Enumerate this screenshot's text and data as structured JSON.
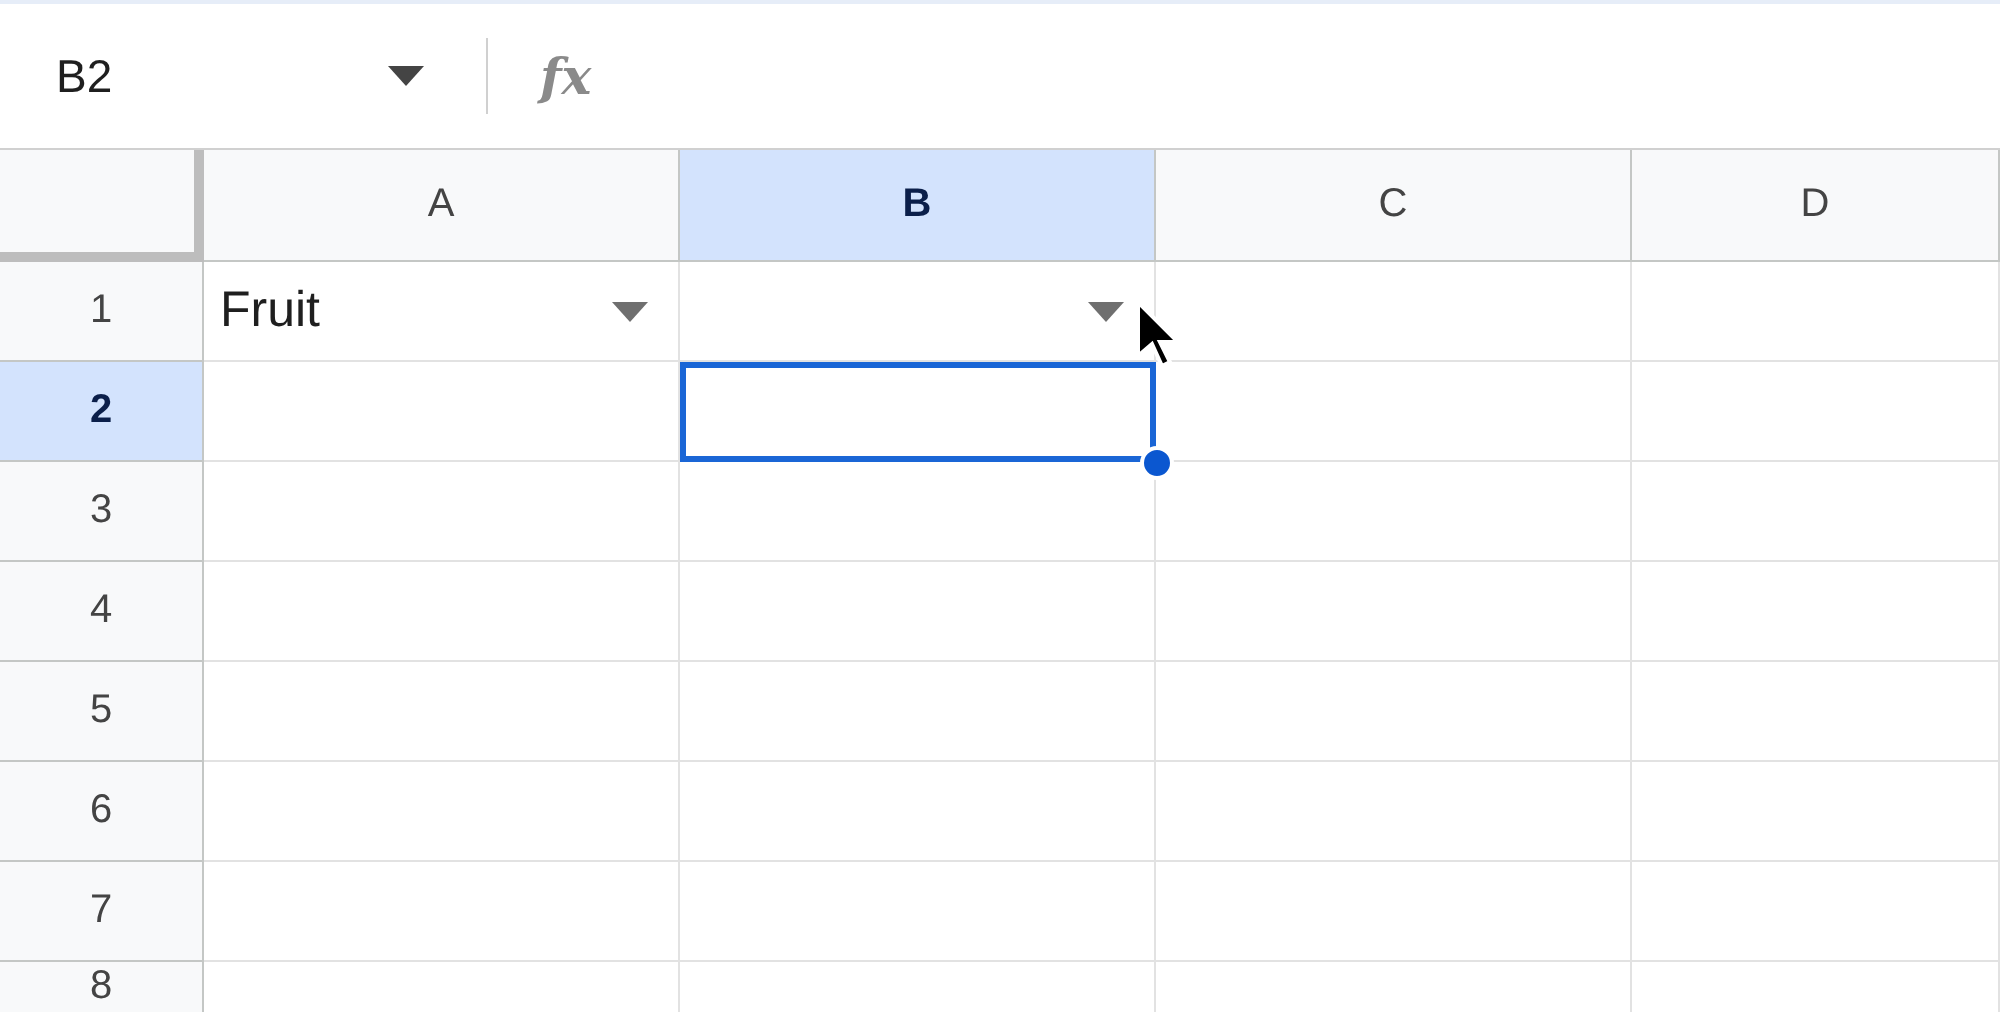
{
  "name_box": {
    "value": "B2"
  },
  "formula_bar": {
    "label": "fx"
  },
  "columns": [
    {
      "label": "A",
      "selected": false
    },
    {
      "label": "B",
      "selected": true
    },
    {
      "label": "C",
      "selected": false
    },
    {
      "label": "D",
      "selected": false
    }
  ],
  "rows": [
    {
      "label": "1",
      "selected": false,
      "cells": [
        {
          "value": "Fruit",
          "dropdown": true,
          "selected": false
        },
        {
          "dropdown": true,
          "selected": false
        },
        {
          "dropdown": false,
          "selected": false
        },
        {
          "dropdown": false,
          "selected": false
        }
      ]
    },
    {
      "label": "2",
      "selected": true,
      "cells": [
        {
          "dropdown": false,
          "selected": false
        },
        {
          "dropdown": false,
          "selected": true
        },
        {
          "dropdown": false,
          "selected": false
        },
        {
          "dropdown": false,
          "selected": false
        }
      ]
    },
    {
      "label": "3",
      "selected": false,
      "cells": [
        {
          "dropdown": false,
          "selected": false
        },
        {
          "dropdown": false,
          "selected": false
        },
        {
          "dropdown": false,
          "selected": false
        },
        {
          "dropdown": false,
          "selected": false
        }
      ]
    },
    {
      "label": "4",
      "selected": false,
      "cells": [
        {
          "dropdown": false,
          "selected": false
        },
        {
          "dropdown": false,
          "selected": false
        },
        {
          "dropdown": false,
          "selected": false
        },
        {
          "dropdown": false,
          "selected": false
        }
      ]
    },
    {
      "label": "5",
      "selected": false,
      "cells": [
        {
          "dropdown": false,
          "selected": false
        },
        {
          "dropdown": false,
          "selected": false
        },
        {
          "dropdown": false,
          "selected": false
        },
        {
          "dropdown": false,
          "selected": false
        }
      ]
    },
    {
      "label": "6",
      "selected": false,
      "cells": [
        {
          "dropdown": false,
          "selected": false
        },
        {
          "dropdown": false,
          "selected": false
        },
        {
          "dropdown": false,
          "selected": false
        },
        {
          "dropdown": false,
          "selected": false
        }
      ]
    },
    {
      "label": "7",
      "selected": false,
      "cells": [
        {
          "dropdown": false,
          "selected": false
        },
        {
          "dropdown": false,
          "selected": false
        },
        {
          "dropdown": false,
          "selected": false
        },
        {
          "dropdown": false,
          "selected": false
        }
      ]
    },
    {
      "label": "8",
      "selected": false,
      "cells": [
        {
          "dropdown": false,
          "selected": false
        },
        {
          "dropdown": false,
          "selected": false
        },
        {
          "dropdown": false,
          "selected": false
        },
        {
          "dropdown": false,
          "selected": false
        }
      ]
    }
  ]
}
